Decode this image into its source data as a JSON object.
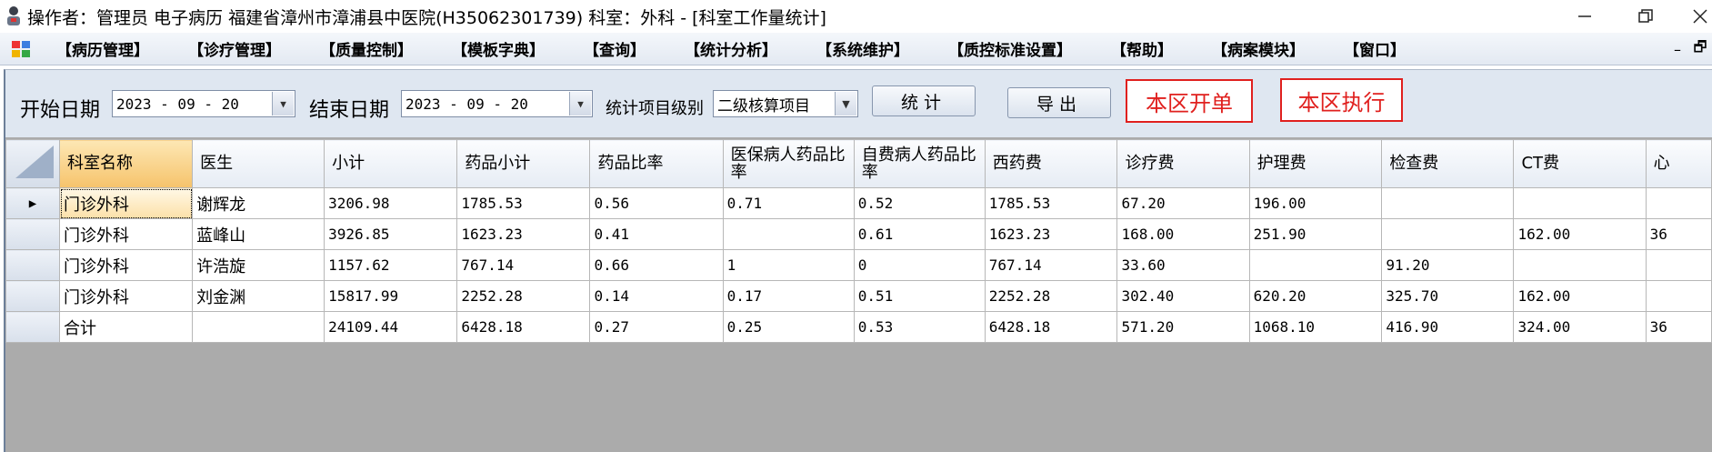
{
  "window": {
    "title": "操作者：管理员 电子病历  福建省漳州市漳浦县中医院(H35062301739)  科室：外科 - [科室工作量统计]",
    "minimize_icon": "minimize-icon",
    "restore_icon": "restore-icon",
    "close_icon": "close-icon"
  },
  "menu": {
    "items": [
      "【病历管理】",
      "【诊疗管理】",
      "【质量控制】",
      "【模板字典】",
      "【查询】",
      "【统计分析】",
      "【系统维护】",
      "【质控标准设置】",
      "【帮助】",
      "【病案模块】",
      "【窗口】"
    ],
    "mdi_minimize": "–",
    "mdi_restore": "🗗"
  },
  "toolbar": {
    "start_label": "开始日期",
    "start_value": "2023 - 09 - 20",
    "end_label": "结束日期",
    "end_value": "2023 - 09 - 20",
    "level_label": "统计项目级别",
    "level_value": "二级核算项目",
    "stat_button": "统计",
    "export_button": "导出",
    "order_link": "本区开单",
    "exec_link": "本区执行"
  },
  "grid": {
    "headers": [
      "科室名称",
      "医生",
      "小计",
      "药品小计",
      "药品比率",
      "医保病人药品比率",
      "自费病人药品比率",
      "西药费",
      "诊疗费",
      "护理费",
      "检查费",
      "CT费",
      "心"
    ],
    "rows": [
      {
        "current": "▶",
        "cells": [
          "门诊外科",
          "谢辉龙",
          "3206.98",
          "1785.53",
          "0.56",
          "0.71",
          "0.52",
          "1785.53",
          "67.20",
          "196.00",
          "",
          "",
          ""
        ]
      },
      {
        "current": "",
        "cells": [
          "门诊外科",
          "蓝峰山",
          "3926.85",
          "1623.23",
          "0.41",
          "",
          "0.61",
          "1623.23",
          "168.00",
          "251.90",
          "",
          "162.00",
          "36"
        ]
      },
      {
        "current": "",
        "cells": [
          "门诊外科",
          "许浩旋",
          "1157.62",
          "767.14",
          "0.66",
          "1",
          "0",
          "767.14",
          "33.60",
          "",
          "91.20",
          "",
          ""
        ]
      },
      {
        "current": "",
        "cells": [
          "门诊外科",
          "刘金渊",
          "15817.99",
          "2252.28",
          "0.14",
          "0.17",
          "0.51",
          "2252.28",
          "302.40",
          "620.20",
          "325.70",
          "162.00",
          ""
        ]
      },
      {
        "current": "",
        "cells": [
          "合计",
          "",
          "24109.44",
          "6428.18",
          "0.27",
          "0.25",
          "0.53",
          "6428.18",
          "571.20",
          "1068.10",
          "416.90",
          "324.00",
          "36"
        ]
      }
    ]
  }
}
